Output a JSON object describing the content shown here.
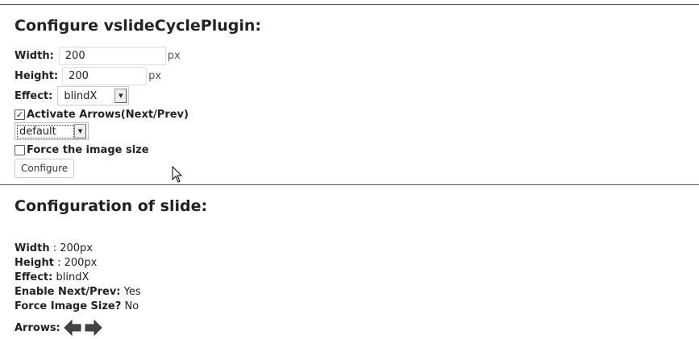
{
  "config_form": {
    "title": "Configure vslideCyclePlugin:",
    "width_label": "Width:",
    "width_value": "200",
    "width_unit": "px",
    "height_label": "Height:",
    "height_value": "200",
    "height_unit": "px",
    "effect_label": "Effect:",
    "effect_value": "blindX",
    "arrows_checkbox_label": "Activate Arrows(Next/Prev)",
    "arrows_checked": true,
    "arrow_style_value": "default",
    "force_size_label": "Force the image size",
    "force_size_checked": false,
    "configure_button": "Configure"
  },
  "slide_config": {
    "title": "Configuration of slide:",
    "width_label": "Width",
    "width_value": ": 200px",
    "height_label": "Height",
    "height_value": ": 200px",
    "effect_label": "Effect:",
    "effect_value": "blindX",
    "next_prev_label": "Enable Next/Prev:",
    "next_prev_value": "Yes",
    "force_label": "Force Image Size?",
    "force_value": "No",
    "arrows_label": "Arrows:"
  }
}
